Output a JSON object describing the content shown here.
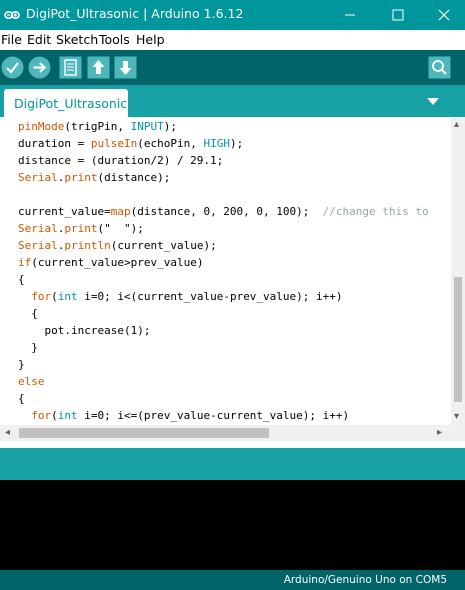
{
  "window": {
    "title": "DigiPot_Ultrasonic | Arduino 1.6.12",
    "min_symbol": "—",
    "max_symbol": "☐",
    "close_symbol": "✕"
  },
  "menu": [
    "File",
    "Edit",
    "Sketch",
    "Tools",
    "Help"
  ],
  "toolbar": {
    "buttons": [
      "verify-icon",
      "upload-icon",
      "new-icon",
      "open-icon",
      "save-icon"
    ],
    "right": "serial-monitor-icon"
  },
  "tab": {
    "label": "DigiPot_Ultrasonic"
  },
  "code": [
    [
      {
        "t": "pinMode",
        "c": "kw"
      },
      {
        "t": "(trigPin, "
      },
      {
        "t": "INPUT",
        "c": "ty"
      },
      {
        "t": ");"
      }
    ],
    [
      {
        "t": "duration = "
      },
      {
        "t": "pulseIn",
        "c": "kw"
      },
      {
        "t": "(echoPin, "
      },
      {
        "t": "HIGH",
        "c": "ty"
      },
      {
        "t": ");"
      }
    ],
    [
      {
        "t": "distance = (duration/2) / 29.1;"
      }
    ],
    [
      {
        "t": "Serial",
        "c": "kw"
      },
      {
        "t": "."
      },
      {
        "t": "print",
        "c": "kw"
      },
      {
        "t": "(distance);"
      }
    ],
    [],
    [
      {
        "t": "current_value="
      },
      {
        "t": "map",
        "c": "kw"
      },
      {
        "t": "(distance, 0, 200, 0, 100);  "
      },
      {
        "t": "//change this to",
        "c": "cm"
      }
    ],
    [
      {
        "t": "Serial",
        "c": "kw"
      },
      {
        "t": "."
      },
      {
        "t": "print",
        "c": "kw"
      },
      {
        "t": "(\"  \");"
      }
    ],
    [
      {
        "t": "Serial",
        "c": "kw"
      },
      {
        "t": "."
      },
      {
        "t": "println",
        "c": "kw"
      },
      {
        "t": "(current_value);"
      }
    ],
    [
      {
        "t": "if",
        "c": "kw"
      },
      {
        "t": "(current_value>prev_value)"
      }
    ],
    [
      {
        "t": "{"
      }
    ],
    [
      {
        "t": "  "
      },
      {
        "t": "for",
        "c": "kw"
      },
      {
        "t": "("
      },
      {
        "t": "int",
        "c": "ty"
      },
      {
        "t": " i=0; i<(current_value-prev_value); i++)"
      }
    ],
    [
      {
        "t": "  {"
      }
    ],
    [
      {
        "t": "    pot.increase(1);"
      }
    ],
    [
      {
        "t": "  }"
      }
    ],
    [
      {
        "t": "}"
      }
    ],
    [
      {
        "t": "else",
        "c": "kw"
      }
    ],
    [
      {
        "t": "{"
      }
    ],
    [
      {
        "t": "  "
      },
      {
        "t": "for",
        "c": "kw"
      },
      {
        "t": "("
      },
      {
        "t": "int",
        "c": "ty"
      },
      {
        "t": " i=0; i<=(prev_value-current_value); i++)"
      }
    ]
  ],
  "status": {
    "board": "Arduino/Genuino Uno on COM5"
  },
  "colors": {
    "title_bar": "#00979c",
    "toolbar": "#006468",
    "tab_bar": "#17a1a5",
    "keyword": "#d35400",
    "constant": "#00979c",
    "comment": "#95a5a6"
  }
}
